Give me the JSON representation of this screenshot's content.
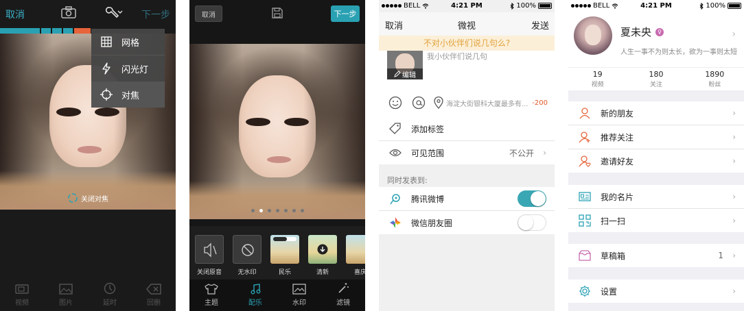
{
  "panel1": {
    "cancel": "取消",
    "next": "下一步",
    "menu": [
      {
        "label": "网格",
        "icon": "grid-icon"
      },
      {
        "label": "闪光灯",
        "icon": "flash-icon"
      },
      {
        "label": "对焦",
        "icon": "focus-icon"
      }
    ],
    "focus_off": "关闭对焦",
    "tabs": [
      {
        "label": "视频",
        "icon": "video-icon"
      },
      {
        "label": "图片",
        "icon": "image-icon"
      },
      {
        "label": "延时",
        "icon": "timer-icon"
      },
      {
        "label": "回删",
        "icon": "backspace-icon"
      }
    ],
    "stripe_colors": [
      "#2aa1b3",
      "#2aa1b3",
      "#2aa1b3",
      "#2aa1b3",
      "#e8643a"
    ]
  },
  "panel2": {
    "cancel": "取消",
    "next": "下一步",
    "page_dots": 7,
    "page_dot_active": 1,
    "effects": [
      {
        "label": "关闭原音"
      },
      {
        "label": "无水印"
      },
      {
        "label": "民乐"
      },
      {
        "label": "清新"
      },
      {
        "label": "喜庆"
      }
    ],
    "tabs": [
      {
        "label": "主题",
        "icon": "shirt-icon"
      },
      {
        "label": "配乐",
        "icon": "music-icon"
      },
      {
        "label": "水印",
        "icon": "watermark-icon"
      },
      {
        "label": "滤镜",
        "icon": "magic-wand-icon"
      }
    ],
    "active_tab": "配乐",
    "accent": "#2aa1b3"
  },
  "status": {
    "carrier": "BELL",
    "time": "4:21 PM",
    "battery": "100%"
  },
  "panel3": {
    "cancel": "取消",
    "title": "微视",
    "send": "发送",
    "hint": "不对小伙伴们说几句么?",
    "edit": "编辑",
    "ghost_text": "我小伙伴们说几句",
    "location": "海淀大街银科大厦最多有...",
    "count": "-200",
    "rows": [
      {
        "label": "添加标签",
        "icon": "tag-icon"
      },
      {
        "label": "可见范围",
        "icon": "eye-icon",
        "value": "不公开"
      }
    ],
    "section_title": "同时发表到:",
    "share": [
      {
        "label": "腾讯微博",
        "icon": "tencent-weibo-icon",
        "on": true
      },
      {
        "label": "微信朋友圈",
        "icon": "wechat-moments-icon",
        "on": false
      }
    ]
  },
  "panel4": {
    "name": "夏未央",
    "bio": "人生一事不为则太长，欲为一事则太短",
    "stats": [
      {
        "num": "19",
        "label": "视频"
      },
      {
        "num": "180",
        "label": "关注"
      },
      {
        "num": "1890",
        "label": "粉丝"
      }
    ],
    "group1": [
      {
        "label": "新的朋友",
        "icon": "new-friend-icon"
      },
      {
        "label": "推荐关注",
        "icon": "recommend-follow-icon"
      },
      {
        "label": "邀请好友",
        "icon": "invite-friend-icon"
      }
    ],
    "group2": [
      {
        "label": "我的名片",
        "icon": "business-card-icon"
      },
      {
        "label": "扫一扫",
        "icon": "qr-scan-icon"
      }
    ],
    "drafts": {
      "label": "草稿箱",
      "count": "1",
      "icon": "drafts-icon"
    },
    "settings": {
      "label": "设置",
      "icon": "settings-icon"
    },
    "accent": "#e8643a"
  }
}
